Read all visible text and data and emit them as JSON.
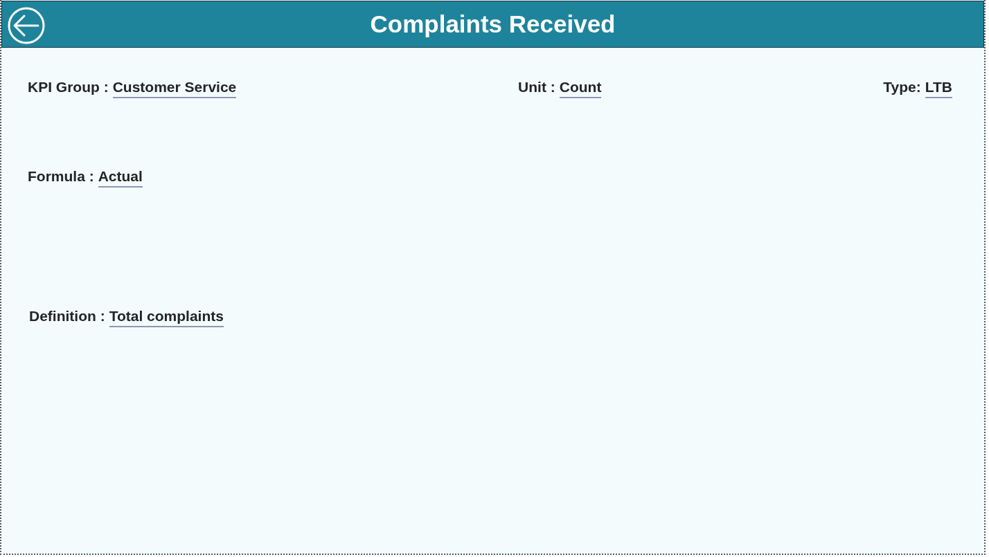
{
  "header": {
    "title": "Complaints Received"
  },
  "rows": [
    {
      "fields": [
        {
          "label": "KPI Group :",
          "value": "Customer Service"
        },
        {
          "label": "Unit :",
          "value": "Count"
        },
        {
          "label": "Type:",
          "value": "LTB"
        }
      ]
    },
    {
      "fields": [
        {
          "label": "Formula :",
          "value": "Actual"
        }
      ]
    },
    {
      "fields": [
        {
          "label": "Definition :",
          "value": "Total complaints"
        }
      ]
    }
  ]
}
